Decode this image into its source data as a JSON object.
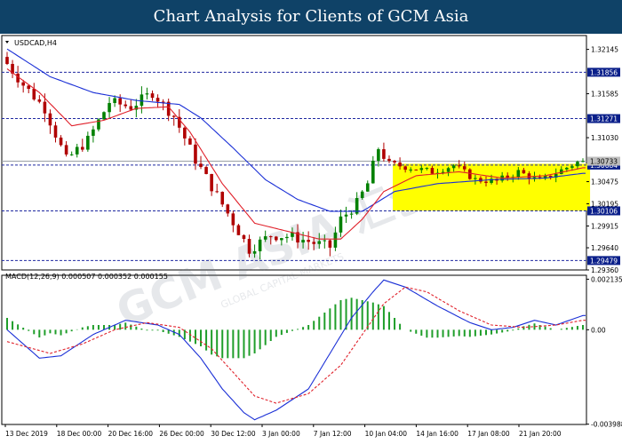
{
  "banner": {
    "title": "Chart Analysis for Clients of GCM Asia"
  },
  "watermark": {
    "brand": "GCM ASIA 汇创",
    "tagline": "GLOBAL CAPITAL MARKETS"
  },
  "colors": {
    "bull": "#008000",
    "bear": "#b00000",
    "ma_fast": "#e0202a",
    "ma_slow": "#1a2fd6",
    "level_line": "#1e28a0",
    "tag_bg": "#0a1f8a",
    "box": "#ffff00",
    "macd_main": "#1a2fd6",
    "macd_signal": "#e0202a",
    "macd_hist": "#1f9e2a"
  },
  "chart_data": [
    {
      "type": "candlestick",
      "title": "USDCAD,H4",
      "ylim": [
        1.2936,
        1.3232
      ],
      "y_ticks": [
        "1.32145",
        "1.31585",
        "1.31030",
        "1.30475",
        "1.30195",
        "1.29915",
        "1.29640",
        "1.29360"
      ],
      "x_labels": [
        "13 Dec 2019",
        "18 Dec 00:00",
        "20 Dec 16:00",
        "26 Dec 00:00",
        "30 Dec 12:00",
        "3 Jan 00:00",
        "7 Jan 12:00",
        "10 Jan 04:00",
        "14 Jan 16:00",
        "17 Jan 08:00",
        "21 Jan 20:00"
      ],
      "levels": [
        {
          "label": "1.31856",
          "value": 1.31856
        },
        {
          "label": "1.31271",
          "value": 1.31271
        },
        {
          "label": "1.30684",
          "value": 1.30684
        },
        {
          "label": "1.30106",
          "value": 1.30106
        },
        {
          "label": "1.29479",
          "value": 1.29479
        }
      ],
      "current_price": {
        "label": "1.30733",
        "value": 1.30733
      },
      "consolidation_box": {
        "x_from": 72,
        "x_to": 108,
        "y_from": 1.3011,
        "y_to": 1.307
      },
      "anchors": [
        [
          0,
          1.3205
        ],
        [
          4,
          1.317
        ],
        [
          8,
          1.314
        ],
        [
          12,
          1.3075
        ],
        [
          16,
          1.31
        ],
        [
          20,
          1.3148
        ],
        [
          24,
          1.3142
        ],
        [
          28,
          1.316
        ],
        [
          32,
          1.313
        ],
        [
          36,
          1.3075
        ],
        [
          40,
          1.303
        ],
        [
          44,
          1.2985
        ],
        [
          46,
          1.2962
        ],
        [
          50,
          1.298
        ],
        [
          54,
          1.2978
        ],
        [
          58,
          1.297
        ],
        [
          61,
          1.2965
        ],
        [
          63,
          1.3
        ],
        [
          66,
          1.302
        ],
        [
          68,
          1.3045
        ],
        [
          70,
          1.309
        ],
        [
          72,
          1.307
        ],
        [
          76,
          1.3065
        ],
        [
          80,
          1.306
        ],
        [
          84,
          1.3068
        ],
        [
          88,
          1.305
        ],
        [
          92,
          1.3048
        ],
        [
          96,
          1.306
        ],
        [
          100,
          1.3048
        ],
        [
          104,
          1.3062
        ],
        [
          107,
          1.3072
        ]
      ],
      "ma_fast_anchors": [
        [
          0,
          1.319
        ],
        [
          6,
          1.316
        ],
        [
          12,
          1.3118
        ],
        [
          18,
          1.3125
        ],
        [
          24,
          1.314
        ],
        [
          30,
          1.3142
        ],
        [
          34,
          1.311
        ],
        [
          40,
          1.3045
        ],
        [
          46,
          1.2995
        ],
        [
          52,
          1.2985
        ],
        [
          58,
          1.2975
        ],
        [
          62,
          1.2975
        ],
        [
          66,
          1.3
        ],
        [
          70,
          1.3035
        ],
        [
          76,
          1.3055
        ],
        [
          84,
          1.306
        ],
        [
          92,
          1.3052
        ],
        [
          100,
          1.3055
        ],
        [
          107,
          1.3065
        ]
      ],
      "ma_slow_anchors": [
        [
          0,
          1.3215
        ],
        [
          8,
          1.318
        ],
        [
          16,
          1.316
        ],
        [
          24,
          1.315
        ],
        [
          32,
          1.3145
        ],
        [
          36,
          1.3128
        ],
        [
          42,
          1.309
        ],
        [
          48,
          1.305
        ],
        [
          54,
          1.3025
        ],
        [
          60,
          1.301
        ],
        [
          66,
          1.301
        ],
        [
          72,
          1.3035
        ],
        [
          80,
          1.3045
        ],
        [
          90,
          1.305
        ],
        [
          100,
          1.3052
        ],
        [
          107,
          1.3058
        ]
      ]
    },
    {
      "type": "macd",
      "title": "MACD(12,26,9) 0.000507 0.000352 0.000155",
      "ylim": [
        -0.004,
        0.0023
      ],
      "y_ticks": [
        "0.002135",
        "0.00",
        "-0.003988"
      ],
      "main_anchors": [
        [
          0,
          0.0
        ],
        [
          6,
          -0.0012
        ],
        [
          10,
          -0.0011
        ],
        [
          16,
          -0.0002
        ],
        [
          22,
          0.0004
        ],
        [
          28,
          0.0002
        ],
        [
          32,
          -0.0002
        ],
        [
          36,
          -0.0012
        ],
        [
          40,
          -0.0025
        ],
        [
          44,
          -0.0035
        ],
        [
          46,
          -0.0038
        ],
        [
          50,
          -0.0034
        ],
        [
          56,
          -0.0025
        ],
        [
          60,
          -0.001
        ],
        [
          64,
          0.0005
        ],
        [
          68,
          0.0016
        ],
        [
          70,
          0.0021
        ],
        [
          74,
          0.0018
        ],
        [
          80,
          0.001
        ],
        [
          86,
          0.0003
        ],
        [
          90,
          0.0
        ],
        [
          94,
          0.0001
        ],
        [
          98,
          0.0004
        ],
        [
          102,
          0.0002
        ],
        [
          107,
          0.0006
        ]
      ],
      "signal_anchors": [
        [
          0,
          -0.0005
        ],
        [
          8,
          -0.001
        ],
        [
          14,
          -0.0006
        ],
        [
          20,
          0.0
        ],
        [
          26,
          0.0003
        ],
        [
          32,
          0.0001
        ],
        [
          38,
          -0.0008
        ],
        [
          42,
          -0.0018
        ],
        [
          46,
          -0.0028
        ],
        [
          50,
          -0.0031
        ],
        [
          56,
          -0.0027
        ],
        [
          62,
          -0.0015
        ],
        [
          66,
          -0.0002
        ],
        [
          70,
          0.0011
        ],
        [
          74,
          0.0018
        ],
        [
          78,
          0.0016
        ],
        [
          84,
          0.0008
        ],
        [
          90,
          0.0002
        ],
        [
          96,
          0.0001
        ],
        [
          102,
          0.0002
        ],
        [
          107,
          0.0004
        ]
      ]
    }
  ]
}
